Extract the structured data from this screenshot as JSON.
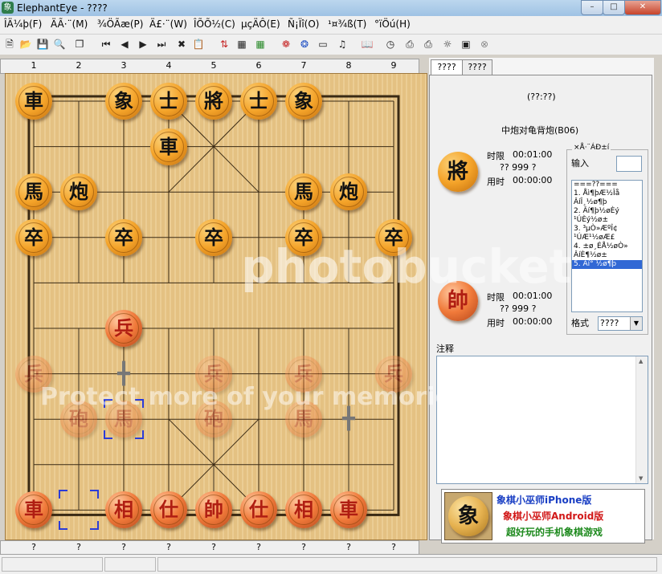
{
  "window": {
    "title": "ElephantEye - ????",
    "app_icon": "象"
  },
  "menu": [
    "ÎÄ¼þ(F)",
    "ÄÃ·¨(M)",
    "¾ÖÃæ(P)",
    "Ä£·¨(W)",
    "ÎÕÕ½(C)",
    "µçÄÔ(E)",
    "Ñ¡Ïî(O)",
    "¹¤¾ß(T)",
    "°ïÖú(H)"
  ],
  "toolbar_icons": [
    "new-file-icon",
    "open-folder-icon",
    "save-icon",
    "print-preview-icon",
    "copy-icon",
    "first-move-icon",
    "prev-move-icon",
    "next-move-icon",
    "last-move-icon",
    "delete-icon",
    "paste-icon",
    "flip-board-icon",
    "edit-board-icon",
    "calculator-icon",
    "color-wheel-icon",
    "compass-icon",
    "monitor-icon",
    "speaker-icon",
    "document-icon",
    "book-icon",
    "clock-icon",
    "printer-icon",
    "printer2-icon",
    "lightbulb-icon",
    "picture-icon",
    "close-circle-icon"
  ],
  "board": {
    "top_columns": [
      "1",
      "2",
      "3",
      "4",
      "5",
      "6",
      "7",
      "8",
      "9"
    ],
    "bottom_columns": [
      "?",
      "?",
      "?",
      "?",
      "?",
      "?",
      "?",
      "?",
      "?"
    ]
  },
  "pieces": [
    {
      "label": "車",
      "col": 0,
      "row": 0,
      "red": false
    },
    {
      "label": "象",
      "col": 2,
      "row": 0,
      "red": false
    },
    {
      "label": "士",
      "col": 3,
      "row": 0,
      "red": false
    },
    {
      "label": "將",
      "col": 4,
      "row": 0,
      "red": false
    },
    {
      "label": "士",
      "col": 5,
      "row": 0,
      "red": false
    },
    {
      "label": "象",
      "col": 6,
      "row": 0,
      "red": false
    },
    {
      "label": "車",
      "col": 3,
      "row": 1,
      "red": false
    },
    {
      "label": "馬",
      "col": 0,
      "row": 2,
      "red": false
    },
    {
      "label": "炮",
      "col": 1,
      "row": 2,
      "red": false
    },
    {
      "label": "馬",
      "col": 6,
      "row": 2,
      "red": false
    },
    {
      "label": "炮",
      "col": 7,
      "row": 2,
      "red": false
    },
    {
      "label": "卒",
      "col": 0,
      "row": 3,
      "red": false
    },
    {
      "label": "卒",
      "col": 2,
      "row": 3,
      "red": false
    },
    {
      "label": "卒",
      "col": 4,
      "row": 3,
      "red": false
    },
    {
      "label": "卒",
      "col": 6,
      "row": 3,
      "red": false
    },
    {
      "label": "卒",
      "col": 8,
      "row": 3,
      "red": false
    },
    {
      "label": "兵",
      "col": 2,
      "row": 5,
      "red": true
    },
    {
      "label": "兵",
      "col": 0,
      "row": 6,
      "red": true,
      "faded": true
    },
    {
      "label": "兵",
      "col": 4,
      "row": 6,
      "red": true,
      "faded": true
    },
    {
      "label": "兵",
      "col": 6,
      "row": 6,
      "red": true,
      "faded": true
    },
    {
      "label": "兵",
      "col": 8,
      "row": 6,
      "red": true,
      "faded": true
    },
    {
      "label": "砲",
      "col": 1,
      "row": 7,
      "red": true,
      "faded": true
    },
    {
      "label": "馬",
      "col": 2,
      "row": 7,
      "red": true,
      "faded": true
    },
    {
      "label": "砲",
      "col": 4,
      "row": 7,
      "red": true,
      "faded": true
    },
    {
      "label": "馬",
      "col": 6,
      "row": 7,
      "red": true,
      "faded": true
    },
    {
      "label": "車",
      "col": 0,
      "row": 9,
      "red": true
    },
    {
      "label": "相",
      "col": 2,
      "row": 9,
      "red": true
    },
    {
      "label": "仕",
      "col": 3,
      "row": 9,
      "red": true
    },
    {
      "label": "帥",
      "col": 4,
      "row": 9,
      "red": true
    },
    {
      "label": "仕",
      "col": 5,
      "row": 9,
      "red": true
    },
    {
      "label": "相",
      "col": 6,
      "row": 9,
      "red": true
    },
    {
      "label": "車",
      "col": 7,
      "row": 9,
      "red": true
    }
  ],
  "markers": {
    "selection_squares": [
      {
        "col": 2,
        "row": 7
      },
      {
        "col": 1,
        "row": 9
      }
    ],
    "crosses": [
      {
        "col": 2,
        "row": 6
      },
      {
        "col": 7,
        "row": 7
      }
    ]
  },
  "right_panel": {
    "tabs": [
      "????",
      "????"
    ],
    "header": "(??:??)",
    "opening_name": "中炮对龟背炮(B06)",
    "black": {
      "piece": "將",
      "time_limit_label": "时限",
      "time_limit": "00:01:00",
      "moves_line": "?? 999 ?",
      "time_used_label": "用时",
      "time_used": "00:00:00"
    },
    "red": {
      "piece": "帥",
      "time_limit_label": "时限",
      "time_limit": "00:01:00",
      "moves_line": "?? 999 ?",
      "time_used_label": "用时",
      "time_used": "00:00:00"
    },
    "groupbox_title": "×Å·¨ÁÐ±í",
    "input_label": "输入",
    "moves": [
      "===??===",
      "1. Åì¶þÆ½Îå",
      "   ÂíÎ¸½ø¶þ",
      "2. Âí¶þ½øÈý",
      "   ¹ÚÈý½ø±",
      "3. ³µÒ»ÆºÎ¢",
      "   ¹ÚÆ¹½øÆ£",
      "4. ±ø¸ÉÅ½øÒ»",
      "   ÂíÈ¶½ø±",
      "5. Âí° ½ø¶þ"
    ],
    "active_move_index": 9,
    "format_label": "格式",
    "format_value": "????",
    "notes_label": "注释"
  },
  "banner": {
    "logo": "象",
    "line1": "象棋小巫师iPhone版",
    "line2": "象棋小巫师Android版",
    "line3": "超好玩的手机象棋游戏",
    "line1_color": "#1a3fc4",
    "line2_color": "#d11818",
    "line3_color": "#1e8a1e"
  },
  "watermark": {
    "line1": "photobucket",
    "line2": "Protect more of your memories for less!"
  }
}
